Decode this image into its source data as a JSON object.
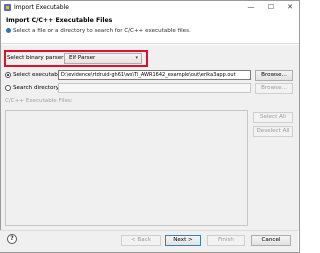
{
  "window": {
    "title": "Import Executable",
    "controls": {
      "minimize": "—",
      "maximize": "☐",
      "close": "✕"
    }
  },
  "banner": {
    "title": "Import C/C++ Executable Files",
    "description": "Select a file or a directory to search for C/C++ executable files."
  },
  "parser": {
    "label": "Select binary parser:",
    "selected": "Elf Parser",
    "highlight_color": "#e0102a"
  },
  "executable": {
    "label": "Select executable:",
    "value": "D:\\evidence\\rtdruid-gh61\\ws\\Ti_AWR1642_example\\out\\erika3app.out",
    "selected": true,
    "browse_label": "Browse..."
  },
  "search": {
    "label": "Search directory:",
    "value": "",
    "selected": false,
    "browse_label": "Browse..."
  },
  "files": {
    "label": "C/C++ Executable Files:",
    "select_all_label": "Select All",
    "deselect_all_label": "Deselect All"
  },
  "footer": {
    "help": "?",
    "back_label": "< Back",
    "next_label": "Next >",
    "finish_label": "Finish",
    "cancel_label": "Cancel"
  }
}
